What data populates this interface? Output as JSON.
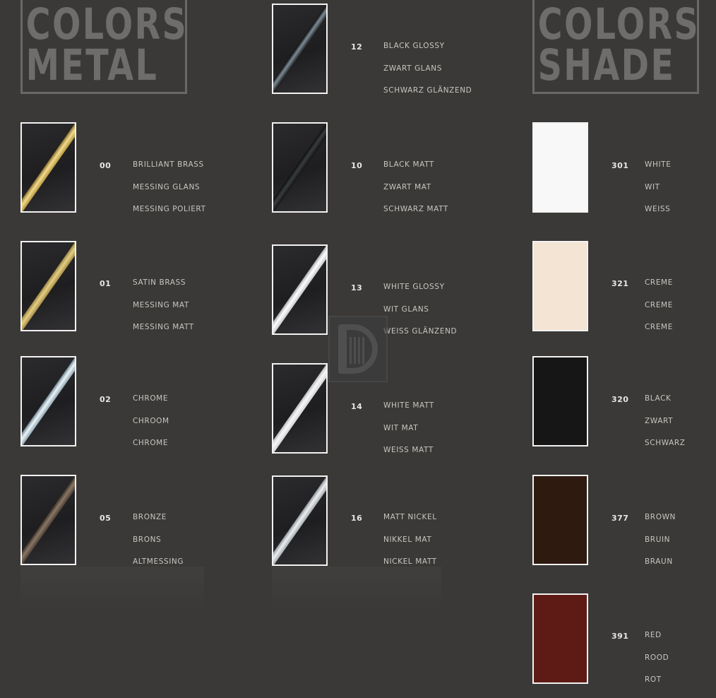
{
  "titles": {
    "metal": [
      "COLORS",
      "METAL"
    ],
    "shade": [
      "COLORS",
      "SHADE"
    ]
  },
  "metal": [
    {
      "code": "00",
      "names": [
        "BRILLIANT BRASS",
        "MESSING GLANS",
        "MESSING POLIERT"
      ],
      "rod": "brass-glossy"
    },
    {
      "code": "01",
      "names": [
        "SATIN BRASS",
        "MESSING MAT",
        "MESSING MATT"
      ],
      "rod": "brass-satin"
    },
    {
      "code": "02",
      "names": [
        "CHROME",
        "CHROOM",
        "CHROME"
      ],
      "rod": "chrome"
    },
    {
      "code": "05",
      "names": [
        "BRONZE",
        "BRONS",
        "ALTMESSING"
      ],
      "rod": "bronze"
    },
    {
      "code": "12",
      "names": [
        "BLACK GLOSSY",
        "ZWART GLANS",
        "SCHWARZ GLÄNZEND"
      ],
      "rod": "black-glossy"
    },
    {
      "code": "10",
      "names": [
        "BLACK MATT",
        "ZWART MAT",
        "SCHWARZ MATT"
      ],
      "rod": "black-matt"
    },
    {
      "code": "13",
      "names": [
        "WHITE GLOSSY",
        "WIT GLANS",
        "WEISS GLÄNZEND"
      ],
      "rod": "white-glossy"
    },
    {
      "code": "14",
      "names": [
        "WHITE MATT",
        "WIT MAT",
        "WEISS MATT"
      ],
      "rod": "white-matt"
    },
    {
      "code": "16",
      "names": [
        "MATT NICKEL",
        "NIKKEL MAT",
        "NICKEL MATT"
      ],
      "rod": "nickel"
    }
  ],
  "shade": [
    {
      "code": "301",
      "names": [
        "WHITE",
        "WIT",
        "WEISS"
      ],
      "color": "#f8f8f9"
    },
    {
      "code": "321",
      "names": [
        "CREME",
        "CREME",
        "CREME"
      ],
      "color": "#f3e4d3"
    },
    {
      "code": "320",
      "names": [
        "BLACK",
        "ZWART",
        "SCHWARZ"
      ],
      "color": "#161616"
    },
    {
      "code": "377",
      "names": [
        "BROWN",
        "BRUIN",
        "BRAUN"
      ],
      "color": "#2f1a10"
    },
    {
      "code": "391",
      "names": [
        "RED",
        "ROOD",
        "ROT"
      ],
      "color": "#5e1a14"
    }
  ],
  "watermark_icon": "d-logo-icon"
}
